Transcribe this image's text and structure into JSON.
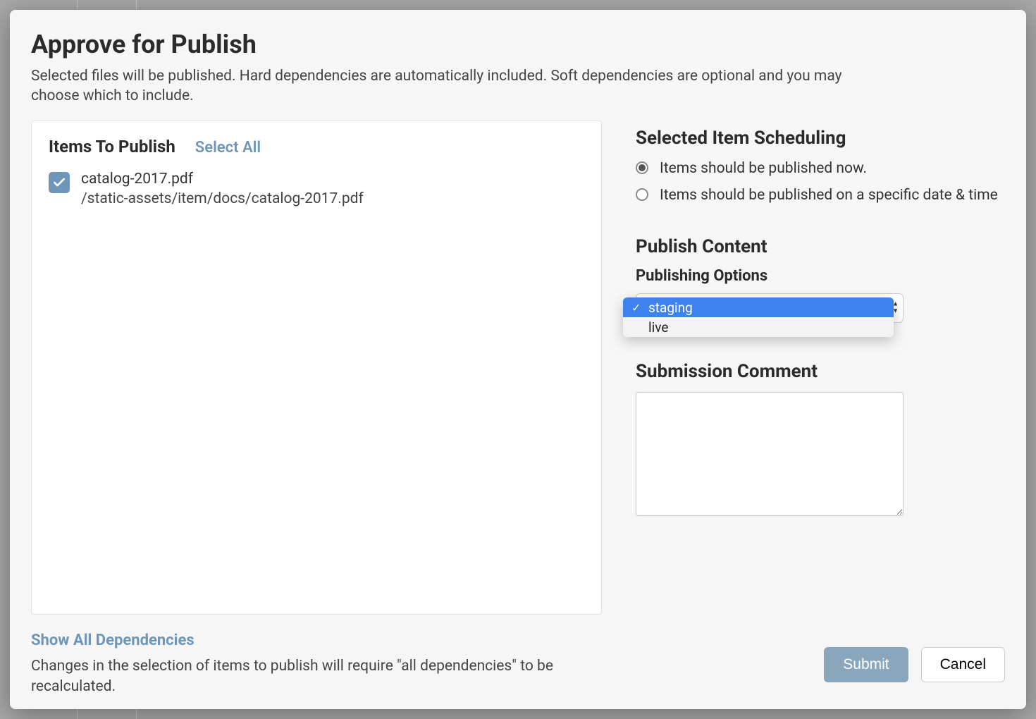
{
  "modal": {
    "title": "Approve for Publish",
    "subtitle": "Selected files will be published. Hard dependencies are automatically included. Soft dependencies are optional and you may choose which to include."
  },
  "itemsPanel": {
    "heading": "Items To Publish",
    "selectAll": "Select All",
    "items": [
      {
        "checked": true,
        "name": "catalog-2017.pdf",
        "path": "/static-assets/item/docs/catalog-2017.pdf"
      }
    ]
  },
  "scheduling": {
    "heading": "Selected Item Scheduling",
    "options": [
      {
        "label": "Items should be published now.",
        "selected": true
      },
      {
        "label": "Items should be published on a specific date & time",
        "selected": false
      }
    ]
  },
  "publish": {
    "heading": "Publish Content",
    "optionsLabel": "Publishing Options",
    "dropdown": {
      "options": [
        "staging",
        "live"
      ],
      "selected": "staging"
    }
  },
  "comment": {
    "heading": "Submission Comment",
    "value": ""
  },
  "dependencies": {
    "showAll": "Show All Dependencies",
    "note": "Changes in the selection of items to publish will require \"all dependencies\" to be recalculated."
  },
  "actions": {
    "submit": "Submit",
    "cancel": "Cancel"
  }
}
